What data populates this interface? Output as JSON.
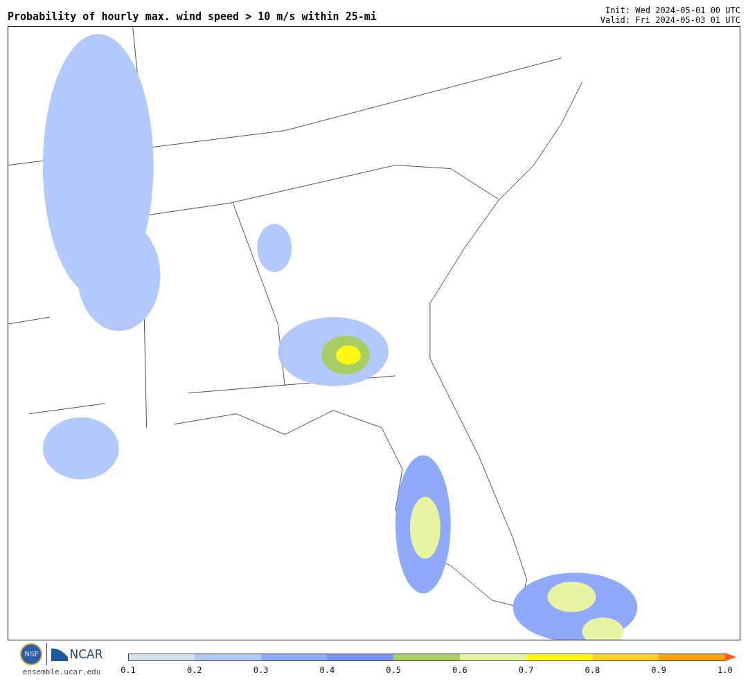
{
  "header": {
    "title": "Probability of hourly max. wind speed > 10 m/s within 25-mi",
    "init": "Init: Wed 2024-05-01 00 UTC",
    "valid": "Valid: Fri 2024-05-03 01 UTC"
  },
  "footer": {
    "nsf_logo": "NSF",
    "ncar_logo": "NCAR",
    "site": "ensemble.ucar.edu"
  },
  "colorbar": {
    "bins": [
      {
        "kind": "box",
        "color": "#d6e2ee"
      },
      {
        "kind": "box",
        "color": "#b3c8fb"
      },
      {
        "kind": "box",
        "color": "#8eaaf8"
      },
      {
        "kind": "box",
        "color": "#7c8ff2"
      },
      {
        "kind": "box",
        "color": "#a7cd64"
      },
      {
        "kind": "box",
        "color": "#e8f4a2"
      },
      {
        "kind": "box",
        "color": "#fff714"
      },
      {
        "kind": "box",
        "color": "#ffd02a"
      },
      {
        "kind": "box",
        "color": "#ffa010"
      },
      {
        "kind": "arrow",
        "color": "#ff5a0a"
      }
    ],
    "ticks": [
      "0.1",
      "0.2",
      "0.3",
      "0.4",
      "0.5",
      "0.6",
      "0.7",
      "0.8",
      "0.9",
      "1.0"
    ]
  }
}
